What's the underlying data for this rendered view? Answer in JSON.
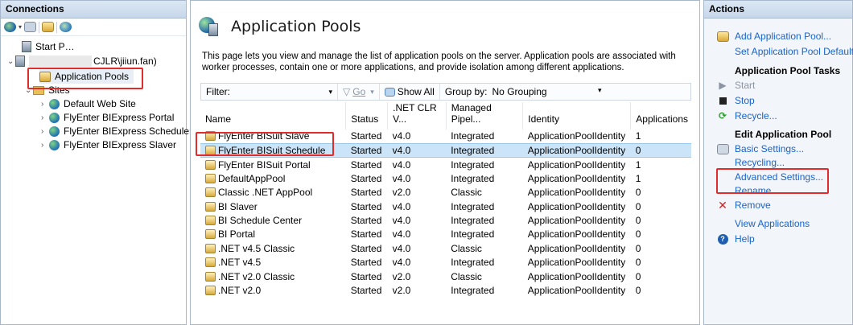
{
  "connections": {
    "title": "Connections",
    "tree": {
      "start_page": "Start P…",
      "server": "CJLR\\jiiun.fan)",
      "application_pools": "Application Pools",
      "sites": "Sites",
      "site_items": [
        "Default Web Site",
        "FlyEnter BIExpress Portal",
        "FlyEnter BIExpress Scheduler",
        "FlyEnter BIExpress Slaver"
      ]
    }
  },
  "center": {
    "title": "Application Pools",
    "description": "This page lets you view and manage the list of application pools on the server. Application pools are associated with worker processes, contain one or more applications, and provide isolation among different applications.",
    "filter_label": "Filter:",
    "go_label": "Go",
    "show_all_label": "Show All",
    "group_by_label": "Group by:",
    "group_by_value": "No Grouping",
    "columns": [
      "Name",
      "Status",
      ".NET CLR V...",
      "Managed Pipel...",
      "Identity",
      "Applications"
    ],
    "rows": [
      [
        "FlyEnter BISuit Slave",
        "Started",
        "v4.0",
        "Integrated",
        "ApplicationPoolIdentity",
        "1"
      ],
      [
        "FlyEnter BISuit Schedule",
        "Started",
        "v4.0",
        "Integrated",
        "ApplicationPoolIdentity",
        "0"
      ],
      [
        "FlyEnter BISuit Portal",
        "Started",
        "v4.0",
        "Integrated",
        "ApplicationPoolIdentity",
        "1"
      ],
      [
        "DefaultAppPool",
        "Started",
        "v4.0",
        "Integrated",
        "ApplicationPoolIdentity",
        "1"
      ],
      [
        "Classic .NET AppPool",
        "Started",
        "v2.0",
        "Classic",
        "ApplicationPoolIdentity",
        "0"
      ],
      [
        "BI Slaver",
        "Started",
        "v4.0",
        "Integrated",
        "ApplicationPoolIdentity",
        "0"
      ],
      [
        "BI Schedule Center",
        "Started",
        "v4.0",
        "Integrated",
        "ApplicationPoolIdentity",
        "0"
      ],
      [
        "BI Portal",
        "Started",
        "v4.0",
        "Integrated",
        "ApplicationPoolIdentity",
        "0"
      ],
      [
        ".NET v4.5 Classic",
        "Started",
        "v4.0",
        "Classic",
        "ApplicationPoolIdentity",
        "0"
      ],
      [
        ".NET v4.5",
        "Started",
        "v4.0",
        "Integrated",
        "ApplicationPoolIdentity",
        "0"
      ],
      [
        ".NET v2.0 Classic",
        "Started",
        "v2.0",
        "Classic",
        "ApplicationPoolIdentity",
        "0"
      ],
      [
        ".NET v2.0",
        "Started",
        "v2.0",
        "Integrated",
        "ApplicationPoolIdentity",
        "0"
      ]
    ]
  },
  "actions": {
    "title": "Actions",
    "add_pool": "Add Application Pool...",
    "set_defaults": "Set Application Pool Defaults...",
    "tasks_header": "Application Pool Tasks",
    "start": "Start",
    "stop": "Stop",
    "recycle": "Recycle...",
    "edit_header": "Edit Application Pool",
    "basic_settings": "Basic Settings...",
    "recycling": "Recycling...",
    "advanced_settings": "Advanced Settings...",
    "rename": "Rename",
    "remove": "Remove",
    "view_applications": "View Applications",
    "help": "Help"
  },
  "colors": {
    "highlight_box": "#e12c2c",
    "link": "#1a64c8",
    "selection": "#cce4f7"
  }
}
